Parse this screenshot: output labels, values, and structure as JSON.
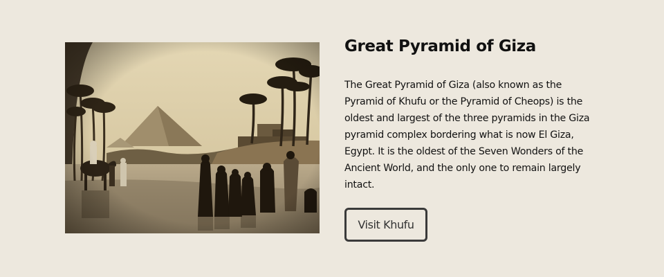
{
  "card": {
    "image_alt": "Vintage sepia photograph of the Great Pyramid of Giza with palm trees, camels and people by the water",
    "title": "Great Pyramid of Giza",
    "description": "The Great Pyramid of Giza (also known as the Pyramid of Khufu or the Pyramid of Cheops) is the oldest and largest of the three pyramids in the Giza pyramid complex bordering what is now El Giza, Egypt. It is the oldest of the Seven Wonders of the Ancient World, and the only one to remain largely intact.",
    "button_label": "Visit Khufu"
  },
  "colors": {
    "background": "#ede8de",
    "text": "#111111",
    "button_border": "#3a3a3a",
    "photo_sepia": "#d9cba6"
  }
}
